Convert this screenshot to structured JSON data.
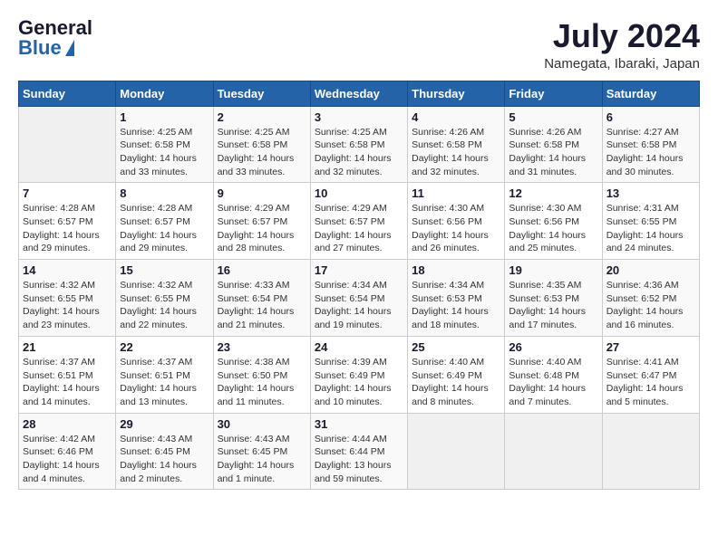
{
  "header": {
    "logo_general": "General",
    "logo_blue": "Blue",
    "month_year": "July 2024",
    "location": "Namegata, Ibaraki, Japan"
  },
  "calendar": {
    "columns": [
      "Sunday",
      "Monday",
      "Tuesday",
      "Wednesday",
      "Thursday",
      "Friday",
      "Saturday"
    ],
    "rows": [
      [
        {
          "day": "",
          "info": ""
        },
        {
          "day": "1",
          "info": "Sunrise: 4:25 AM\nSunset: 6:58 PM\nDaylight: 14 hours\nand 33 minutes."
        },
        {
          "day": "2",
          "info": "Sunrise: 4:25 AM\nSunset: 6:58 PM\nDaylight: 14 hours\nand 33 minutes."
        },
        {
          "day": "3",
          "info": "Sunrise: 4:25 AM\nSunset: 6:58 PM\nDaylight: 14 hours\nand 32 minutes."
        },
        {
          "day": "4",
          "info": "Sunrise: 4:26 AM\nSunset: 6:58 PM\nDaylight: 14 hours\nand 32 minutes."
        },
        {
          "day": "5",
          "info": "Sunrise: 4:26 AM\nSunset: 6:58 PM\nDaylight: 14 hours\nand 31 minutes."
        },
        {
          "day": "6",
          "info": "Sunrise: 4:27 AM\nSunset: 6:58 PM\nDaylight: 14 hours\nand 30 minutes."
        }
      ],
      [
        {
          "day": "7",
          "info": "Sunrise: 4:28 AM\nSunset: 6:57 PM\nDaylight: 14 hours\nand 29 minutes."
        },
        {
          "day": "8",
          "info": "Sunrise: 4:28 AM\nSunset: 6:57 PM\nDaylight: 14 hours\nand 29 minutes."
        },
        {
          "day": "9",
          "info": "Sunrise: 4:29 AM\nSunset: 6:57 PM\nDaylight: 14 hours\nand 28 minutes."
        },
        {
          "day": "10",
          "info": "Sunrise: 4:29 AM\nSunset: 6:57 PM\nDaylight: 14 hours\nand 27 minutes."
        },
        {
          "day": "11",
          "info": "Sunrise: 4:30 AM\nSunset: 6:56 PM\nDaylight: 14 hours\nand 26 minutes."
        },
        {
          "day": "12",
          "info": "Sunrise: 4:30 AM\nSunset: 6:56 PM\nDaylight: 14 hours\nand 25 minutes."
        },
        {
          "day": "13",
          "info": "Sunrise: 4:31 AM\nSunset: 6:55 PM\nDaylight: 14 hours\nand 24 minutes."
        }
      ],
      [
        {
          "day": "14",
          "info": "Sunrise: 4:32 AM\nSunset: 6:55 PM\nDaylight: 14 hours\nand 23 minutes."
        },
        {
          "day": "15",
          "info": "Sunrise: 4:32 AM\nSunset: 6:55 PM\nDaylight: 14 hours\nand 22 minutes."
        },
        {
          "day": "16",
          "info": "Sunrise: 4:33 AM\nSunset: 6:54 PM\nDaylight: 14 hours\nand 21 minutes."
        },
        {
          "day": "17",
          "info": "Sunrise: 4:34 AM\nSunset: 6:54 PM\nDaylight: 14 hours\nand 19 minutes."
        },
        {
          "day": "18",
          "info": "Sunrise: 4:34 AM\nSunset: 6:53 PM\nDaylight: 14 hours\nand 18 minutes."
        },
        {
          "day": "19",
          "info": "Sunrise: 4:35 AM\nSunset: 6:53 PM\nDaylight: 14 hours\nand 17 minutes."
        },
        {
          "day": "20",
          "info": "Sunrise: 4:36 AM\nSunset: 6:52 PM\nDaylight: 14 hours\nand 16 minutes."
        }
      ],
      [
        {
          "day": "21",
          "info": "Sunrise: 4:37 AM\nSunset: 6:51 PM\nDaylight: 14 hours\nand 14 minutes."
        },
        {
          "day": "22",
          "info": "Sunrise: 4:37 AM\nSunset: 6:51 PM\nDaylight: 14 hours\nand 13 minutes."
        },
        {
          "day": "23",
          "info": "Sunrise: 4:38 AM\nSunset: 6:50 PM\nDaylight: 14 hours\nand 11 minutes."
        },
        {
          "day": "24",
          "info": "Sunrise: 4:39 AM\nSunset: 6:49 PM\nDaylight: 14 hours\nand 10 minutes."
        },
        {
          "day": "25",
          "info": "Sunrise: 4:40 AM\nSunset: 6:49 PM\nDaylight: 14 hours\nand 8 minutes."
        },
        {
          "day": "26",
          "info": "Sunrise: 4:40 AM\nSunset: 6:48 PM\nDaylight: 14 hours\nand 7 minutes."
        },
        {
          "day": "27",
          "info": "Sunrise: 4:41 AM\nSunset: 6:47 PM\nDaylight: 14 hours\nand 5 minutes."
        }
      ],
      [
        {
          "day": "28",
          "info": "Sunrise: 4:42 AM\nSunset: 6:46 PM\nDaylight: 14 hours\nand 4 minutes."
        },
        {
          "day": "29",
          "info": "Sunrise: 4:43 AM\nSunset: 6:45 PM\nDaylight: 14 hours\nand 2 minutes."
        },
        {
          "day": "30",
          "info": "Sunrise: 4:43 AM\nSunset: 6:45 PM\nDaylight: 14 hours\nand 1 minute."
        },
        {
          "day": "31",
          "info": "Sunrise: 4:44 AM\nSunset: 6:44 PM\nDaylight: 13 hours\nand 59 minutes."
        },
        {
          "day": "",
          "info": ""
        },
        {
          "day": "",
          "info": ""
        },
        {
          "day": "",
          "info": ""
        }
      ]
    ]
  }
}
